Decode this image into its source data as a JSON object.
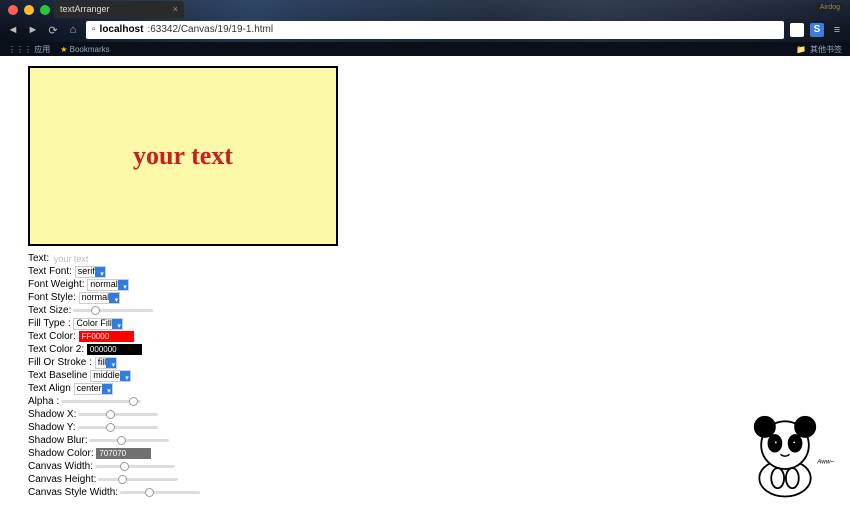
{
  "browser": {
    "tab_title": "textArranger",
    "url_host": "localhost",
    "url_rest": ":63342/Canvas/19/19-1.html",
    "bookmarks_label": "Bookmarks",
    "apps_label": "应用",
    "other_bookmarks": "其他书签",
    "airdog": "Airdog"
  },
  "canvas": {
    "display_text": "your text"
  },
  "controls": {
    "text": {
      "label": "Text:",
      "value": "your text"
    },
    "font": {
      "label": "Text Font:",
      "value": "serif"
    },
    "weight": {
      "label": "Font Weight:",
      "value": "normal"
    },
    "style": {
      "label": "Font Style:",
      "value": "normal"
    },
    "size": {
      "label": "Text Size:"
    },
    "filltype": {
      "label": "Fill Type :",
      "value": "Color Fill"
    },
    "color1": {
      "label": "Text Color:",
      "value": "FF0000",
      "hex": "#ff0000"
    },
    "color2": {
      "label": "Text Color 2:",
      "value": "000000",
      "hex": "#000000"
    },
    "fillstroke": {
      "label": "Fill Or Stroke :",
      "value": "fill"
    },
    "baseline": {
      "label": "Text Baseline",
      "value": "middle"
    },
    "align": {
      "label": "Text Align",
      "value": "center"
    },
    "alpha": {
      "label": "Alpha :"
    },
    "shadowx": {
      "label": "Shadow X:"
    },
    "shadowy": {
      "label": "Shadow Y:"
    },
    "shadowblur": {
      "label": "Shadow Blur:"
    },
    "shadowcolor": {
      "label": "Shadow Color:",
      "value": "707070",
      "hex": "#707070"
    },
    "cwidth": {
      "label": "Canvas Width:"
    },
    "cheight": {
      "label": "Canvas Height:"
    },
    "cswidth": {
      "label": "Canvas Style Width:"
    }
  }
}
